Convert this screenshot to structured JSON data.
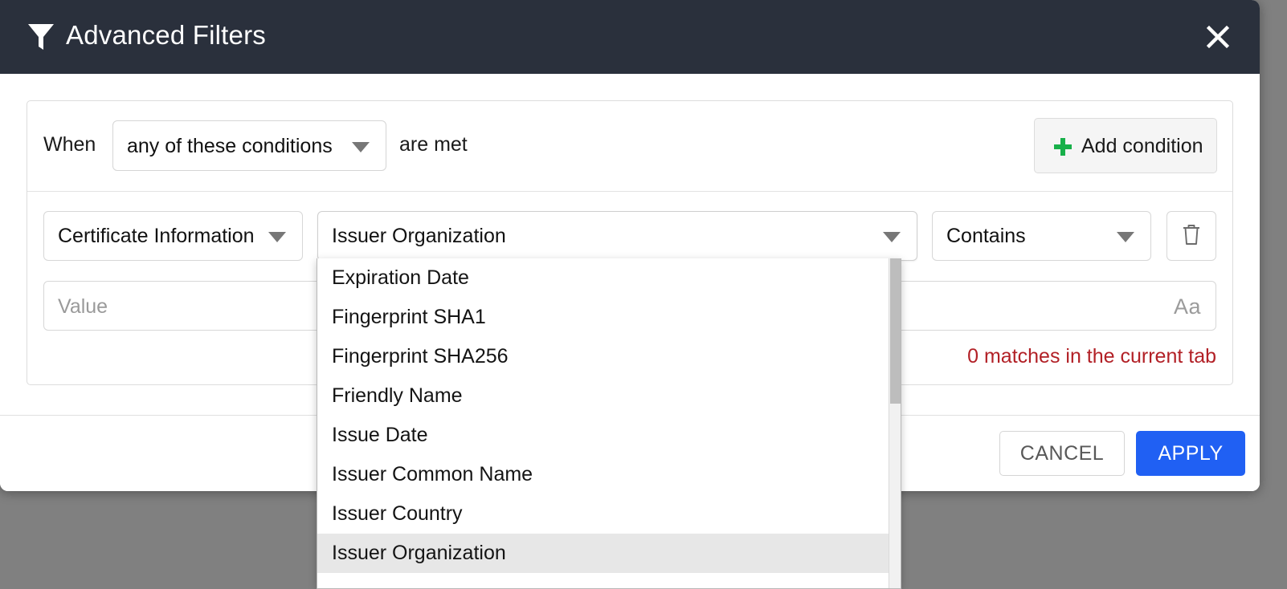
{
  "overlay": {
    "color": "#808080"
  },
  "dialog": {
    "header": {
      "title": "Advanced Filters",
      "icon": "funnel-icon",
      "close_icon": "close-icon",
      "background": "#2a303c"
    },
    "when_row": {
      "when_label": "When",
      "match_type_value": "any of these conditions",
      "are_met_label": "are met",
      "add_condition_label": "Add condition",
      "add_icon": "plus-icon",
      "plus_color": "#18b04a"
    },
    "condition": {
      "category_value": "Certificate Information",
      "field_value": "Issuer Organization",
      "operator_value": "Contains",
      "delete_icon": "trash-icon",
      "value_placeholder": "Value",
      "value_text": "",
      "case_toggle_label": "Aa",
      "matches_text": "0 matches in the current tab",
      "matches_color": "#b22026"
    },
    "field_dropdown": {
      "open": true,
      "selected": "Issuer Organization",
      "items": [
        "Expiration Date",
        "Fingerprint SHA1",
        "Fingerprint SHA256",
        "Friendly Name",
        "Issue Date",
        "Issuer Common Name",
        "Issuer Country",
        "Issuer Organization"
      ]
    },
    "footer": {
      "cancel_label": "CANCEL",
      "apply_label": "APPLY",
      "apply_color": "#2060f3"
    }
  }
}
